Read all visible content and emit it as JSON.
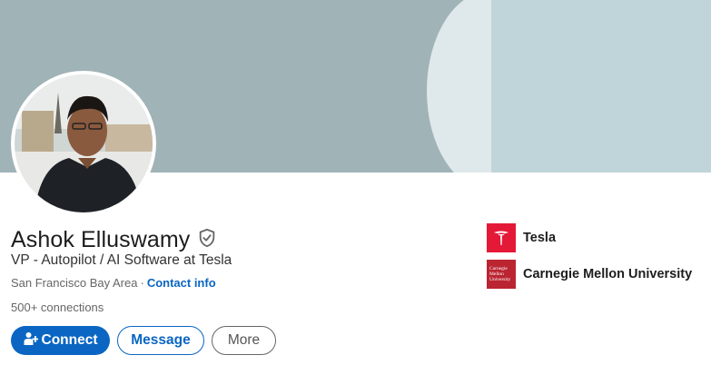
{
  "profile": {
    "name": "Ashok Elluswamy",
    "headline": "VP - Autopilot / AI Software at Tesla",
    "location": "San Francisco Bay Area",
    "separator": "·",
    "contact_label": "Contact info",
    "connections": "500+ connections"
  },
  "actions": {
    "connect_label": "Connect",
    "message_label": "Message",
    "more_label": "More"
  },
  "organizations": [
    {
      "name": "Tesla",
      "logo": "tesla-logo"
    },
    {
      "name": "Carnegie Mellon University",
      "logo": "cmu-logo",
      "logo_text": "Carnegie Mellon University"
    }
  ],
  "colors": {
    "accent": "#0a66c2",
    "banner": "#a0b3b7",
    "tesla_red": "#e31937",
    "cmu_red": "#bb2431"
  }
}
